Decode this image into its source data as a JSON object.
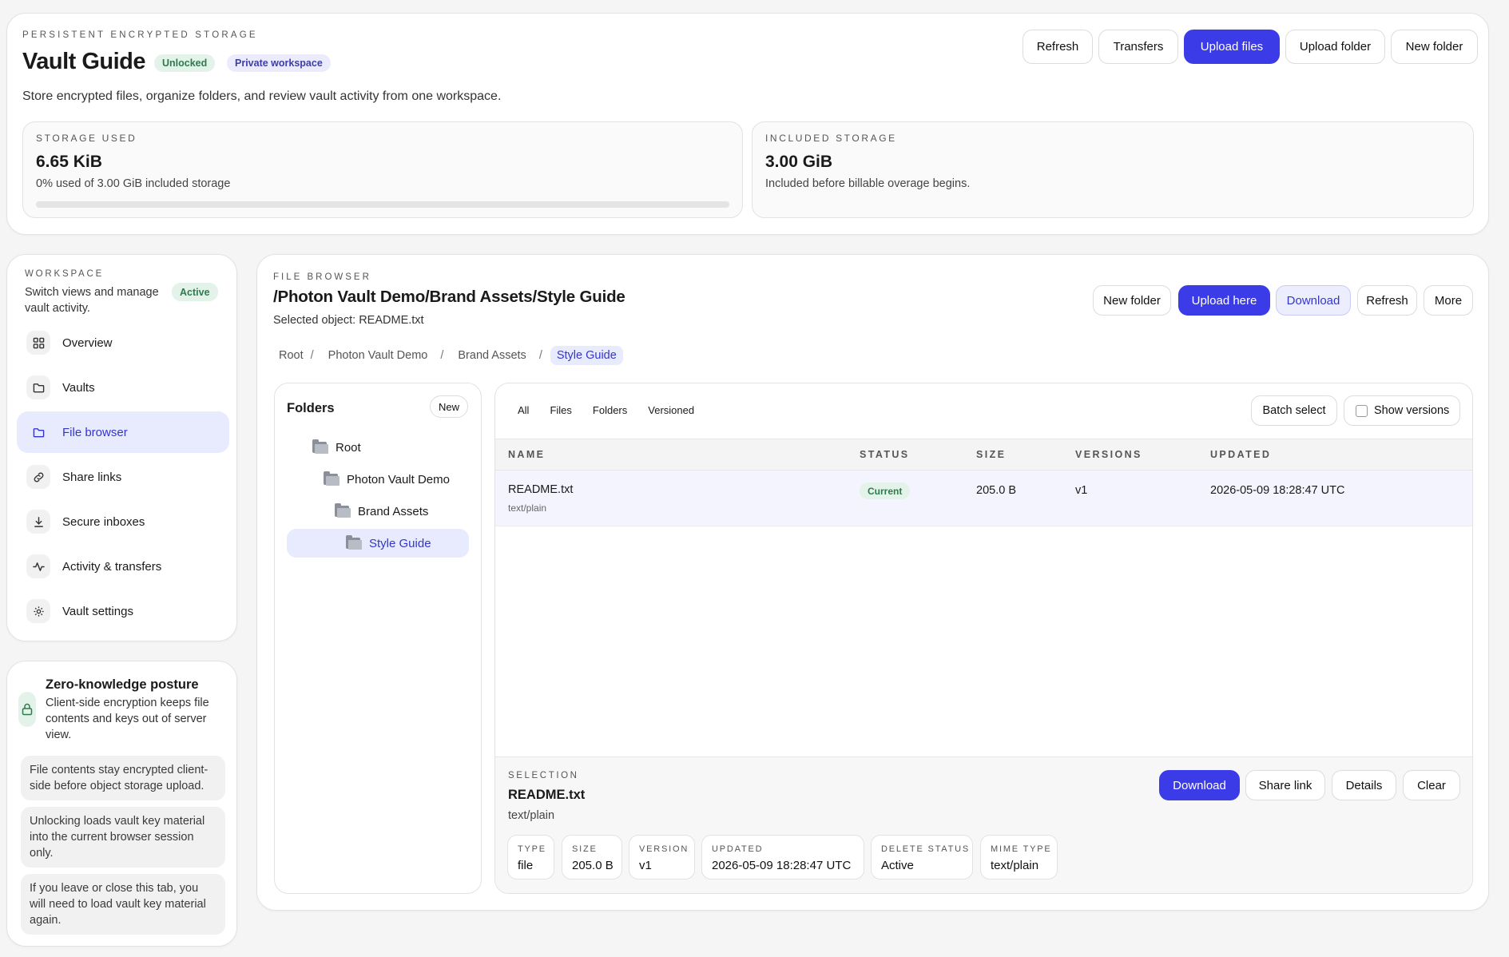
{
  "header": {
    "eyebrow": "PERSISTENT ENCRYPTED STORAGE",
    "title": "Vault Guide",
    "badge_unlocked": "Unlocked",
    "badge_workspace": "Private workspace",
    "subtitle": "Store encrypted files, organize folders, and review vault activity from one workspace.",
    "buttons": {
      "refresh": "Refresh",
      "transfers": "Transfers",
      "upload_files": "Upload files",
      "upload_folder": "Upload folder",
      "new_folder": "New folder"
    },
    "storage_used": {
      "label": "STORAGE USED",
      "value": "6.65 KiB",
      "detail": "0% used of 3.00 GiB included storage",
      "progress_percent": 0
    },
    "included_storage": {
      "label": "INCLUDED STORAGE",
      "value": "3.00 GiB",
      "detail": "Included before billable overage begins."
    }
  },
  "sidebar": {
    "eyebrow": "WORKSPACE",
    "description": "Switch views and manage vault activity.",
    "status_badge": "Active",
    "items": [
      {
        "label": "Overview",
        "icon": "grid-icon"
      },
      {
        "label": "Vaults",
        "icon": "folder-icon"
      },
      {
        "label": "File browser",
        "icon": "folder-icon",
        "active": true
      },
      {
        "label": "Share links",
        "icon": "link-icon"
      },
      {
        "label": "Secure inboxes",
        "icon": "download-icon"
      },
      {
        "label": "Activity & transfers",
        "icon": "activity-icon"
      },
      {
        "label": "Vault settings",
        "icon": "gear-icon"
      }
    ]
  },
  "posture": {
    "title": "Zero-knowledge posture",
    "description": "Client-side encryption keeps file contents and keys out of server view.",
    "notes": [
      "File contents stay encrypted client-side before object storage upload.",
      "Unlocking loads vault key material into the current browser session only.",
      "If you leave or close this tab, you will need to load vault key material again."
    ]
  },
  "browser": {
    "eyebrow": "FILE BROWSER",
    "path": "/Photon Vault Demo/Brand Assets/Style Guide",
    "selected": "Selected object: README.txt",
    "buttons": {
      "new_folder": "New folder",
      "upload_here": "Upload here",
      "download": "Download",
      "refresh": "Refresh",
      "more": "More"
    },
    "breadcrumbs": [
      "Root",
      "Photon Vault Demo",
      "Brand Assets",
      "Style Guide"
    ],
    "breadcrumb_sep": "/",
    "folders_panel": {
      "title": "Folders",
      "new_button": "New",
      "tree": [
        "Root",
        "Photon Vault Demo",
        "Brand Assets",
        "Style Guide"
      ]
    },
    "filters": [
      "All",
      "Files",
      "Folders",
      "Versioned"
    ],
    "batch_select": "Batch select",
    "show_versions": "Show versions",
    "columns": [
      "NAME",
      "STATUS",
      "SIZE",
      "VERSIONS",
      "UPDATED"
    ],
    "rows": [
      {
        "name": "README.txt",
        "mime": "text/plain",
        "status": "Current",
        "size": "205.0 B",
        "versions": "v1",
        "updated": "2026-05-09 18:28:47 UTC"
      }
    ],
    "selection": {
      "eyebrow": "SELECTION",
      "name": "README.txt",
      "mime": "text/plain",
      "buttons": {
        "download": "Download",
        "share_link": "Share link",
        "details": "Details",
        "clear": "Clear"
      },
      "meta": [
        {
          "k": "TYPE",
          "v": "file"
        },
        {
          "k": "SIZE",
          "v": "205.0 B"
        },
        {
          "k": "VERSION",
          "v": "v1"
        },
        {
          "k": "UPDATED",
          "v": "2026-05-09 18:28:47 UTC"
        },
        {
          "k": "DELETE STATUS",
          "v": "Active"
        },
        {
          "k": "MIME TYPE",
          "v": "text/plain"
        }
      ]
    }
  },
  "colors": {
    "accent": "#3b3ce8",
    "accent_soft": "#e8eafd",
    "success_bg": "#e3f3ea",
    "success_text": "#2f7a4c"
  }
}
